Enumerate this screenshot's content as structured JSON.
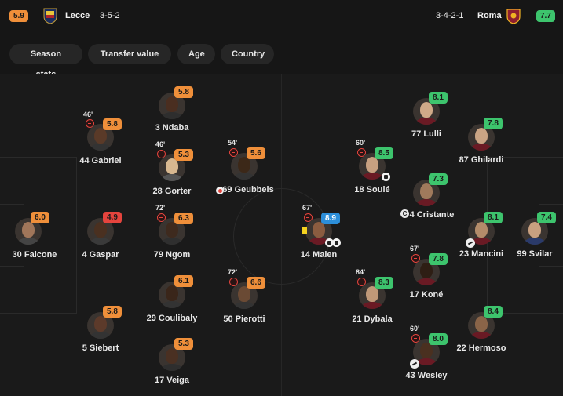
{
  "header": {
    "home": {
      "name": "Lecce",
      "rating": "5.9",
      "formation": "3-5-2",
      "crest_icon": "lecce-crest-icon"
    },
    "away": {
      "name": "Roma",
      "rating": "7.7",
      "formation": "3-4-2-1",
      "crest_icon": "roma-crest-icon"
    }
  },
  "tabs": [
    "Season stats",
    "Transfer value",
    "Age",
    "Country"
  ],
  "colors": {
    "orange": "#ef8f3a",
    "green": "#3dc46d",
    "red": "#e5443d",
    "blue": "#2c8ed9",
    "background": "#161616"
  },
  "players": {
    "falcone": {
      "label": "30 Falcone",
      "rating": "6.0"
    },
    "gabriel": {
      "label": "44 Gabriel",
      "rating": "5.8",
      "minute": "46'"
    },
    "gaspar": {
      "label": "4 Gaspar",
      "rating": "4.9"
    },
    "siebert": {
      "label": "5 Siebert",
      "rating": "5.8"
    },
    "ndaba": {
      "label": "3 Ndaba",
      "rating": "5.8"
    },
    "gorter": {
      "label": "28 Gorter",
      "rating": "5.3",
      "minute": "46'"
    },
    "ngom": {
      "label": "79 Ngom",
      "rating": "6.3",
      "minute": "72'"
    },
    "coulibaly": {
      "label": "29 Coulibaly",
      "rating": "6.1"
    },
    "veiga": {
      "label": "17 Veiga",
      "rating": "5.3"
    },
    "geubbels": {
      "label": "69 Geubbels",
      "rating": "5.6",
      "minute": "54'"
    },
    "pierotti": {
      "label": "50 Pierotti",
      "rating": "6.6",
      "minute": "72'"
    },
    "malen": {
      "label": "14 Malen",
      "rating": "8.9",
      "minute": "67'"
    },
    "soule": {
      "label": "18 Soulé",
      "rating": "8.5",
      "minute": "60'"
    },
    "dybala": {
      "label": "21 Dybala",
      "rating": "8.3",
      "minute": "84'"
    },
    "lulli": {
      "label": "77 Lulli",
      "rating": "8.1"
    },
    "cristante": {
      "label": "4 Cristante",
      "rating": "7.3"
    },
    "kone": {
      "label": "17 Koné",
      "rating": "7.8",
      "minute": "67'"
    },
    "wesley": {
      "label": "43 Wesley",
      "rating": "8.0",
      "minute": "60'"
    },
    "ghilardi": {
      "label": "87 Ghilardi",
      "rating": "7.8"
    },
    "mancini": {
      "label": "23 Mancini",
      "rating": "8.1"
    },
    "hermoso": {
      "label": "22 Hermoso",
      "rating": "8.4"
    },
    "svilar": {
      "label": "99 Svilar",
      "rating": "7.4"
    }
  },
  "captain_mark": "C"
}
